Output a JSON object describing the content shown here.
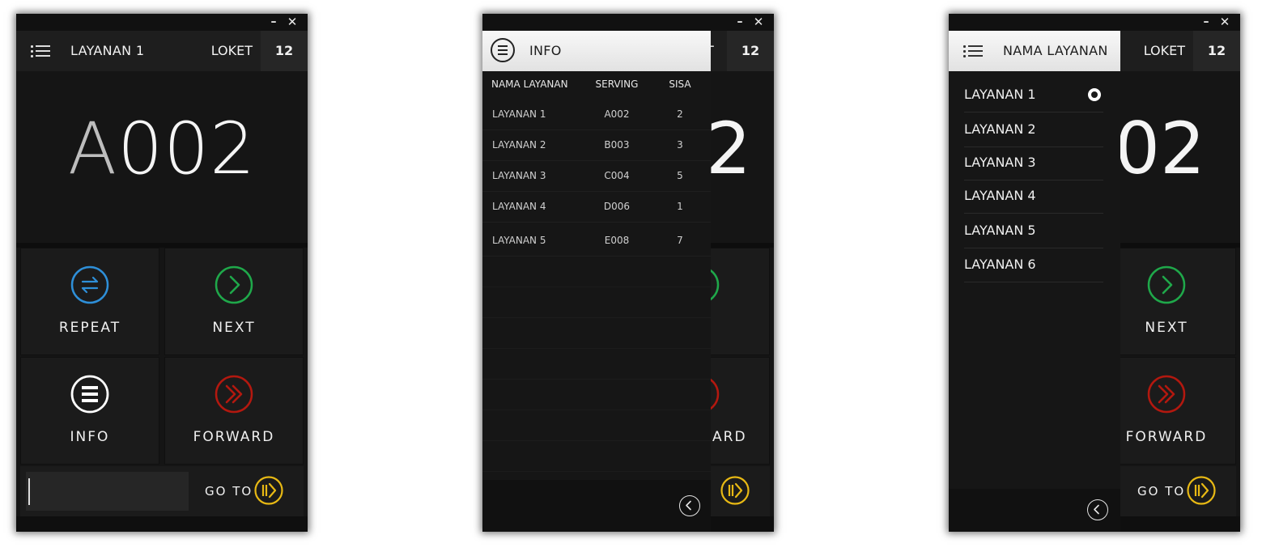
{
  "window_controls": {
    "minimize": "–",
    "close": "✕"
  },
  "main": {
    "service_title": "LAYANAN 1",
    "loket_label": "LOKET",
    "loket_number": "12",
    "ticket_prefix": "A",
    "ticket_digits": "002",
    "buttons": {
      "repeat": "REPEAT",
      "next": "NEXT",
      "info": "INFO",
      "forward": "FORWARD"
    },
    "goto_label": "GO TO",
    "goto_value": ""
  },
  "info_panel": {
    "title": "INFO",
    "columns": [
      "NAMA LAYANAN",
      "SERVING",
      "SISA"
    ],
    "rows": [
      {
        "name": "LAYANAN 1",
        "serving": "A002",
        "sisa": "2"
      },
      {
        "name": "LAYANAN 2",
        "serving": "B003",
        "sisa": "3"
      },
      {
        "name": "LAYANAN 3",
        "serving": "C004",
        "sisa": "5"
      },
      {
        "name": "LAYANAN 4",
        "serving": "D006",
        "sisa": "1"
      },
      {
        "name": "LAYANAN 5",
        "serving": "E008",
        "sisa": "7"
      }
    ]
  },
  "service_panel": {
    "title": "NAMA LAYANAN",
    "items": [
      "LAYANAN 1",
      "LAYANAN 2",
      "LAYANAN 3",
      "LAYANAN 4",
      "LAYANAN 5",
      "LAYANAN 6"
    ],
    "selected_index": 0
  },
  "partial_visible": {
    "w2_loket_fragment": "T",
    "w2_ticket_fragment": "2",
    "w2_next_fragment": "T",
    "w2_forward_fragment": "ARD",
    "w3_ticket_fragment": "02"
  },
  "colors": {
    "repeat": "#2e8fd8",
    "next": "#1fa84a",
    "info": "#ffffff",
    "forward": "#b3180f",
    "goto": "#e8b914"
  },
  "icons": {
    "menu": "list-menu-icon",
    "repeat": "repeat-arrows-icon",
    "next": "chevron-right-circle-icon",
    "info": "menu-circle-icon",
    "forward": "double-chevron-circle-icon",
    "goto": "skip-forward-circle-icon",
    "back": "chevron-left-circle-icon"
  }
}
